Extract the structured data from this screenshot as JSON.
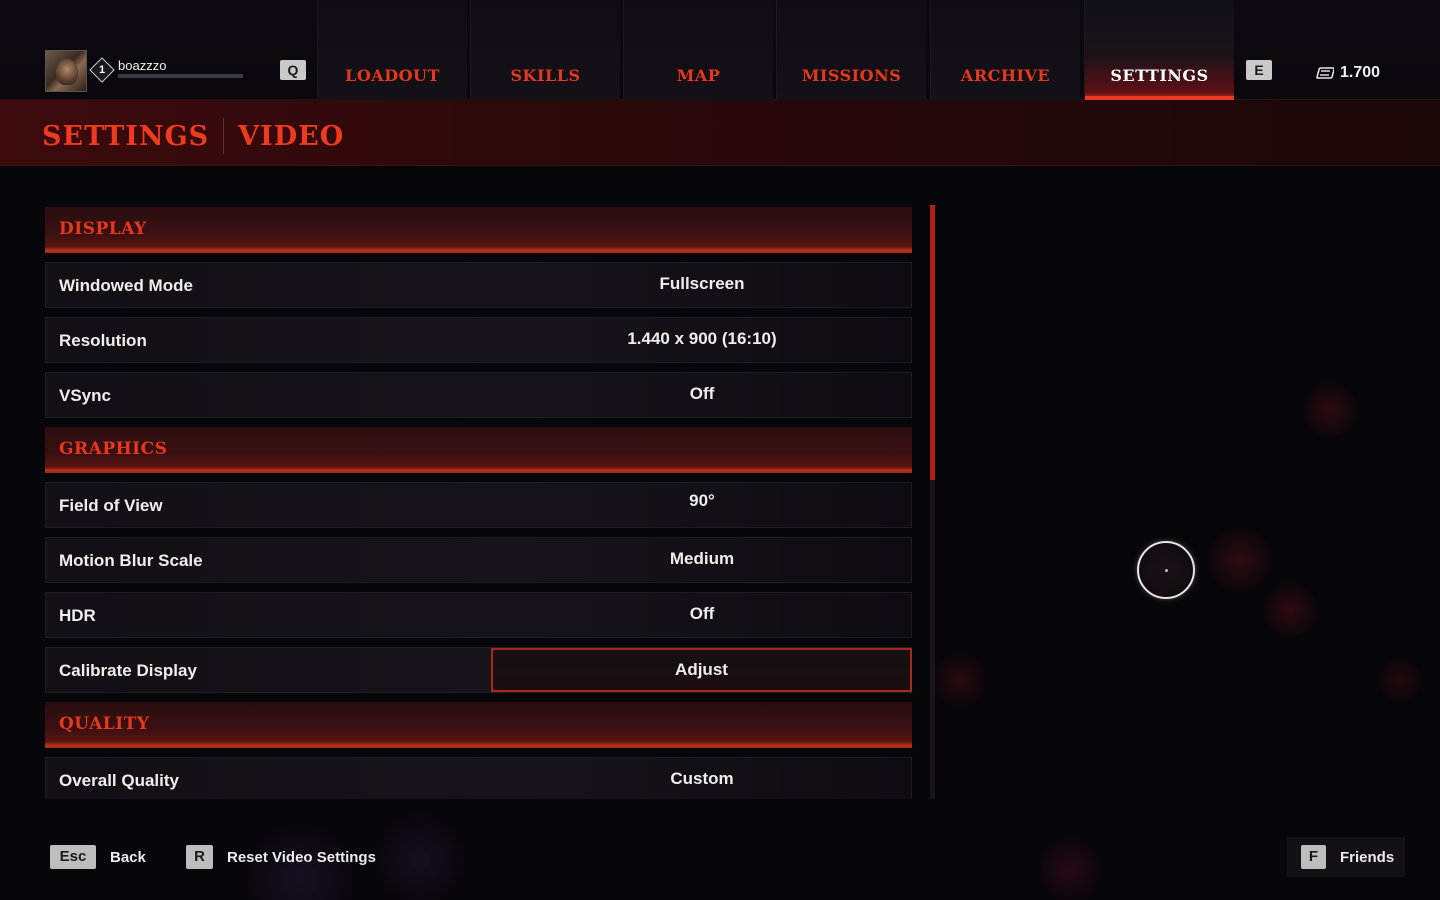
{
  "profile": {
    "username": "boazzzo",
    "level": "1",
    "xp_progress": 0.0
  },
  "nav": {
    "left_key": "Q",
    "right_key": "E",
    "tabs": [
      {
        "label": "LOADOUT",
        "active": false
      },
      {
        "label": "SKILLS",
        "active": false
      },
      {
        "label": "MAP",
        "active": false
      },
      {
        "label": "MISSIONS",
        "active": false
      },
      {
        "label": "ARCHIVE",
        "active": false
      },
      {
        "label": "SETTINGS",
        "active": true
      }
    ]
  },
  "currency": {
    "amount": "1.700",
    "icon": "currency-icon"
  },
  "header": {
    "title": "SETTINGS",
    "subtitle": "VIDEO"
  },
  "sections": [
    {
      "title": "DISPLAY",
      "rows": [
        {
          "label": "Windowed Mode",
          "value": "Fullscreen"
        },
        {
          "label": "Resolution",
          "value": "1.440 x 900 (16:10)"
        },
        {
          "label": "VSync",
          "value": "Off"
        }
      ]
    },
    {
      "title": "GRAPHICS",
      "rows": [
        {
          "label": "Field of View",
          "value": "90°"
        },
        {
          "label": "Motion Blur Scale",
          "value": "Medium"
        },
        {
          "label": "HDR",
          "value": "Off"
        },
        {
          "label": "Calibrate Display",
          "value": "Adjust"
        }
      ]
    },
    {
      "title": "QUALITY",
      "rows": [
        {
          "label": "Overall Quality",
          "value": "Custom"
        }
      ]
    }
  ],
  "footer": {
    "back": {
      "key": "Esc",
      "label": "Back"
    },
    "reset": {
      "key": "R",
      "label": "Reset Video Settings"
    },
    "friends": {
      "key": "F",
      "label": "Friends"
    }
  },
  "colors": {
    "accent": "#e8381c",
    "background": "#07060a",
    "header_band": "#3c0a0c"
  }
}
